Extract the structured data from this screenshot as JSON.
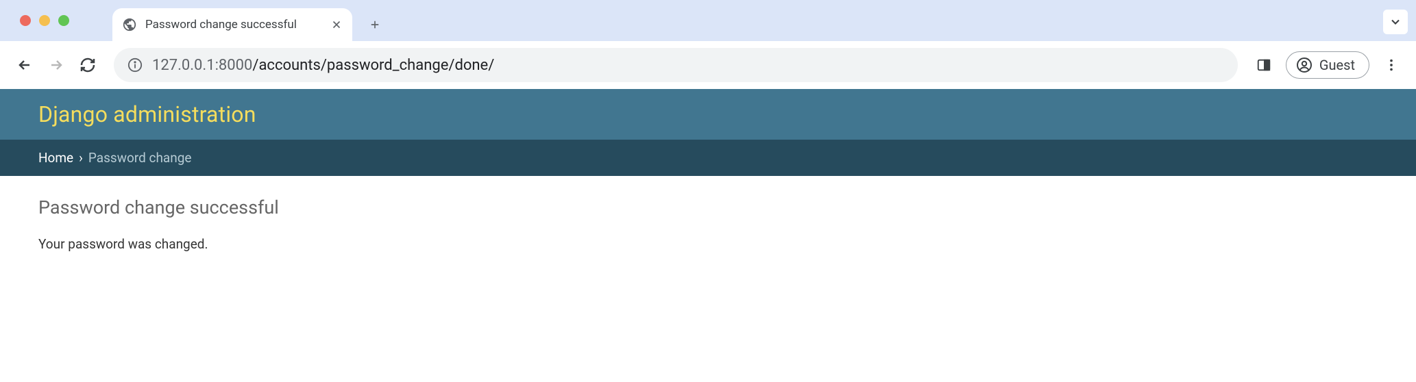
{
  "browser": {
    "tab_title": "Password change successful",
    "url_host": "127.0.0.1",
    "url_port": ":8000",
    "url_path": "/accounts/password_change/done/",
    "profile_label": "Guest"
  },
  "admin": {
    "header_title": "Django administration",
    "breadcrumbs": {
      "home": "Home",
      "separator": "›",
      "current": "Password change"
    },
    "page_title": "Password change successful",
    "page_message": "Your password was changed."
  }
}
